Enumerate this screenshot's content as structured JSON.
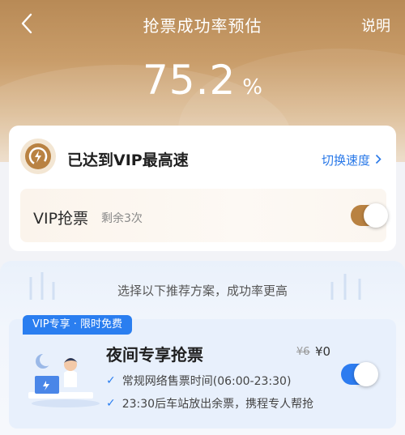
{
  "header": {
    "title": "抢票成功率预估",
    "right_label": "说明",
    "success_rate": "75.2",
    "success_rate_unit": "%"
  },
  "speed_card": {
    "title": "已达到VIP最高速",
    "switch_label": "切换速度",
    "vip_label": "VIP抢票",
    "vip_remaining": "剩余3次",
    "vip_enabled": true
  },
  "plan_section": {
    "tip": "选择以下推荐方案，成功率更高",
    "item": {
      "badge": "VIP专享 · 限时免费",
      "title": "夜间专享抢票",
      "original_price": "¥6",
      "price": "¥0",
      "features": [
        "常规网络售票时间(06:00-23:30)",
        "23:30后车站放出余票，携程专人帮抢"
      ],
      "enabled": true
    }
  },
  "colors": {
    "accent_blue": "#2a7ef0",
    "vip_brown": "#b98242",
    "hero_gold": "#c99d6a"
  }
}
